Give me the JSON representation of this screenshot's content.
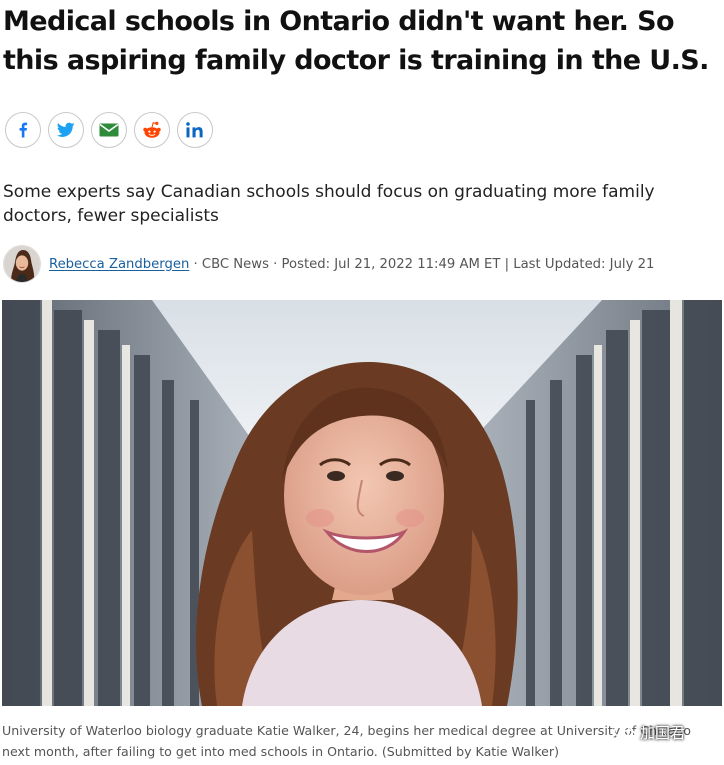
{
  "article": {
    "headline": "Medical schools in Ontario didn't want her. So this aspiring family doctor is training in the U.S.",
    "deck": "Some experts say Canadian schools should focus on graduating more family doctors, fewer specialists",
    "byline": {
      "author": "Rebecca Zandbergen",
      "details": " · CBC News · Posted: Jul 21, 2022 11:49 AM ET | Last Updated: July 21"
    },
    "caption": "University of Waterloo biology graduate Katie Walker, 24, begins her medical degree at University of Chicago next month, after failing to get into med schools in Ontario. (Submitted by Katie Walker)"
  },
  "share": [
    {
      "network": "facebook",
      "icon": "facebook-icon",
      "color": "#1877f2"
    },
    {
      "network": "twitter",
      "icon": "twitter-icon",
      "color": "#1da1f2"
    },
    {
      "network": "email",
      "icon": "email-icon",
      "color": "#2e8b3a"
    },
    {
      "network": "reddit",
      "icon": "reddit-icon",
      "color": "#ff4500"
    },
    {
      "network": "linkedin",
      "icon": "linkedin-icon",
      "color": "#0a66c2"
    }
  ],
  "watermark": {
    "text": "加国君"
  }
}
